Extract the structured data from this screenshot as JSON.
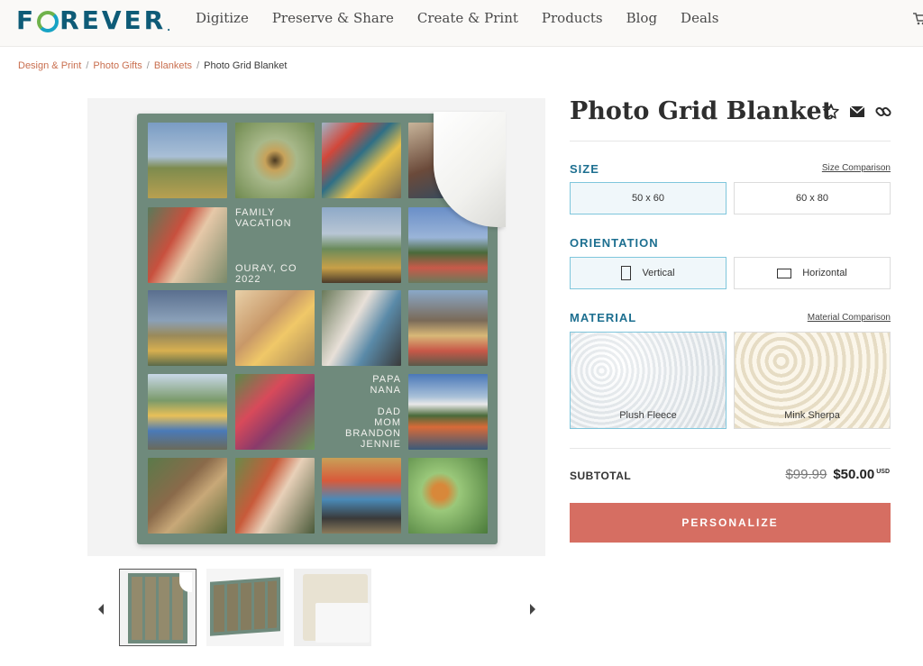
{
  "brand": {
    "logo_text": "FOREVER"
  },
  "nav": {
    "items": [
      "Digitize",
      "Preserve & Share",
      "Create & Print",
      "Products",
      "Blog",
      "Deals"
    ]
  },
  "breadcrumb": {
    "links": [
      "Design & Print",
      "Photo Gifts",
      "Blankets"
    ],
    "separator": "/",
    "current": "Photo Grid Blanket"
  },
  "product": {
    "title": "Photo Grid Blanket",
    "blanket_text": {
      "family": "FAMILY",
      "vacation": "VACATION",
      "place": "OURAY, CO",
      "year": "2022",
      "names": [
        "PAPA",
        "NANA",
        "DAD",
        "MOM",
        "BRANDON",
        "JENNIE"
      ]
    }
  },
  "icons": [
    "star-icon",
    "envelope-icon",
    "link-icon",
    "chevron-left-icon",
    "chevron-right-icon",
    "cart-icon"
  ],
  "options": {
    "size": {
      "label": "SIZE",
      "comparison_link": "Size Comparison",
      "choices": [
        "50 x 60",
        "60 x 80"
      ],
      "selected": "50 x 60"
    },
    "orientation": {
      "label": "ORIENTATION",
      "choices": [
        "Vertical",
        "Horizontal"
      ],
      "selected": "Vertical"
    },
    "material": {
      "label": "MATERIAL",
      "comparison_link": "Material Comparison",
      "choices": [
        "Plush Fleece",
        "Mink Sherpa"
      ],
      "selected": "Plush Fleece"
    }
  },
  "pricing": {
    "label": "SUBTOTAL",
    "original_price": "$99.99",
    "sale_price": "$50.00",
    "currency": "USD"
  },
  "cta": {
    "label": "PERSONALIZE"
  },
  "colors": {
    "brand_blue": "#0e5b77",
    "accent_teal": "#1d6f90",
    "cta": "#d66e62",
    "breadcrumb_link": "#c96f4f",
    "blanket_green": "#6f8a7c"
  }
}
